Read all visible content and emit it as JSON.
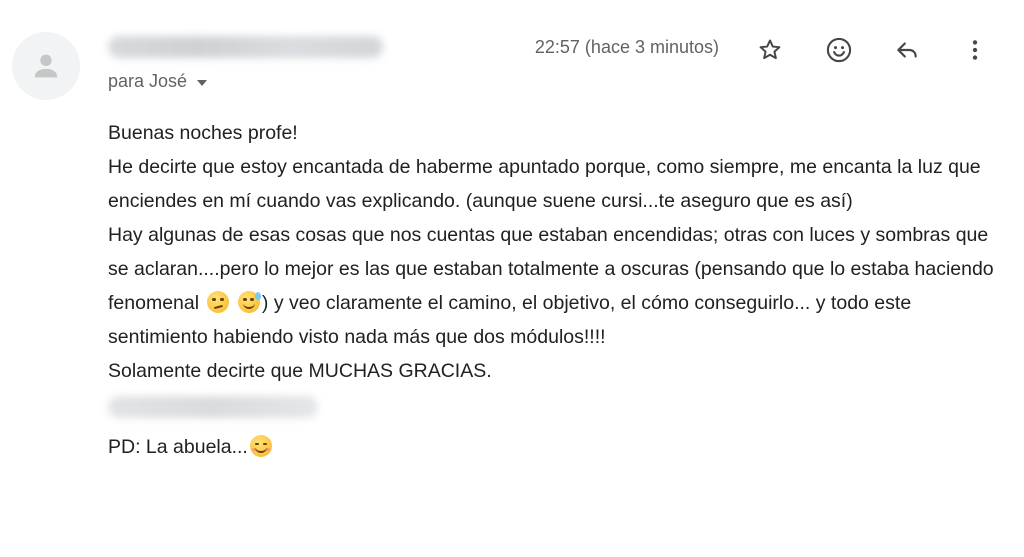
{
  "header": {
    "recipient_prefix": "para",
    "recipient_name": "José",
    "timestamp": "22:57 (hace 3 minutos)"
  },
  "actions": [
    {
      "name": "star-icon"
    },
    {
      "name": "emoji-reaction-icon"
    },
    {
      "name": "reply-icon"
    },
    {
      "name": "more-vert-icon"
    }
  ],
  "body": {
    "greeting": "Buenas noches profe!",
    "p1": "He decirte que estoy encantada de haberme apuntado porque, como siempre, me encanta la luz que enciendes en mí cuando vas explicando. (aunque suene cursi...te aseguro que es así)",
    "p2_before_emoji": "Hay algunas de esas cosas que nos cuentas que estaban encendidas; otras con luces y sombras que se aclaran....pero lo mejor es las que estaban totalmente a oscuras (pensando que lo estaba haciendo fenomenal",
    "p2_after_emoji": ") y veo claramente el  camino, el objetivo, el cómo conseguirlo... y todo este sentimiento  habiendo visto nada más que dos módulos!!!!",
    "closing": "Solamente decirte que MUCHAS GRACIAS.",
    "ps": "PD: La abuela..."
  },
  "colors": {
    "text": "#202124",
    "secondary": "#5f6368",
    "avatar_bg": "#f1f3f4",
    "avatar_icon": "#c4c7c5"
  },
  "emojis": [
    "smirking-face",
    "grinning-face-with-sweat",
    "smiling-face-with-blush"
  ]
}
